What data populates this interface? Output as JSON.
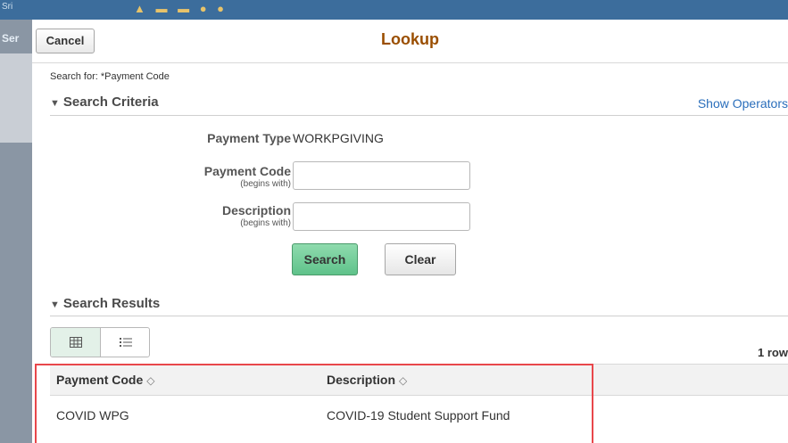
{
  "background": {
    "tab_text": "Sri",
    "sidebar_text": "Ser"
  },
  "modal": {
    "cancel_label": "Cancel",
    "title": "Lookup",
    "search_for": "Search for:  *Payment Code"
  },
  "criteria": {
    "heading": "Search Criteria",
    "show_operators": "Show Operators",
    "payment_type_label": "Payment Type",
    "payment_type_value": "WORKPGIVING",
    "payment_code_label": "Payment Code",
    "payment_code_sub": "(begins with)",
    "payment_code_value": "",
    "description_label": "Description",
    "description_sub": "(begins with)",
    "description_value": "",
    "search_label": "Search",
    "clear_label": "Clear"
  },
  "results": {
    "heading": "Search Results",
    "row_count": "1 row",
    "columns": [
      "Payment Code",
      "Description"
    ],
    "rows": [
      [
        "COVID WPG",
        "COVID-19 Student Support Fund"
      ]
    ]
  },
  "colors": {
    "title": "#9a4e00",
    "link": "#2a6ebb",
    "search_button": "#5fc28a",
    "highlight_box": "#e8474b"
  }
}
